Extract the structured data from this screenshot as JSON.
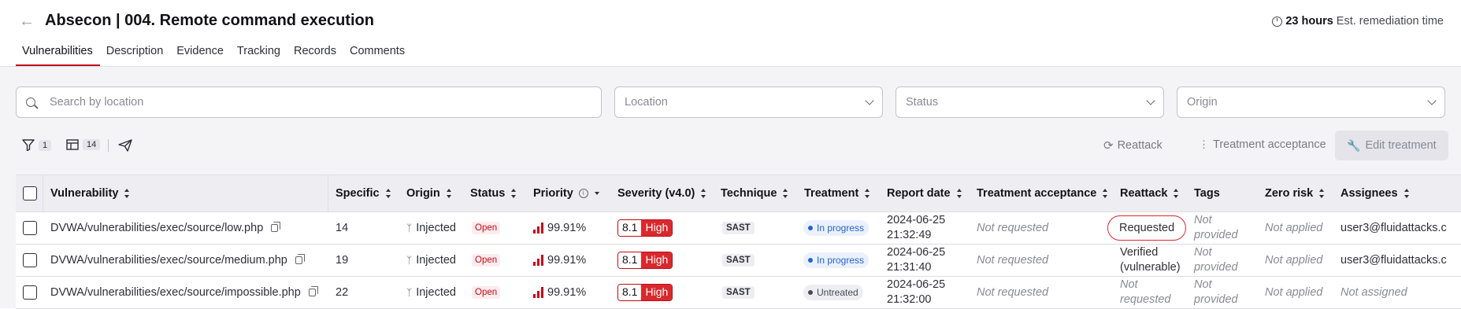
{
  "header": {
    "title": "Absecon | 004. Remote command execution",
    "remediation_hours": "23 hours",
    "remediation_label": "Est. remediation time"
  },
  "tabs": [
    {
      "label": "Vulnerabilities",
      "active": true
    },
    {
      "label": "Description"
    },
    {
      "label": "Evidence"
    },
    {
      "label": "Tracking"
    },
    {
      "label": "Records"
    },
    {
      "label": "Comments"
    }
  ],
  "filters": {
    "search_placeholder": "Search by location",
    "location_placeholder": "Location",
    "status_placeholder": "Status",
    "origin_placeholder": "Origin"
  },
  "toolbar": {
    "filter_count": "1",
    "columns_count": "14",
    "reattack_label": "Reattack",
    "treatment_acceptance_label": "Treatment acceptance",
    "edit_treatment_label": "Edit treatment"
  },
  "table": {
    "columns": [
      "Vulnerability",
      "Specific",
      "Origin",
      "Status",
      "Priority",
      "Severity (v4.0)",
      "Technique",
      "Treatment",
      "Report date",
      "Treatment acceptance",
      "Reattack",
      "Tags",
      "Zero risk",
      "Assignees"
    ],
    "rows": [
      {
        "vulnerability": "DVWA/vulnerabilities/exec/source/low.php",
        "specific": "14",
        "origin": "Injected",
        "status": "Open",
        "priority": "99.91%",
        "severity_score": "8.1",
        "severity_label": "High",
        "technique": "SAST",
        "treatment": "In progress",
        "report_date_line1": "2024-06-25",
        "report_date_line2": "21:32:49",
        "treatment_acceptance": "Not requested",
        "reattack_line1": "Requested",
        "reattack_line2": "",
        "tags_line1": "Not",
        "tags_line2": "provided",
        "zero_risk": "Not applied",
        "assignees": "user3@fluidattacks.c"
      },
      {
        "vulnerability": "DVWA/vulnerabilities/exec/source/medium.php",
        "specific": "19",
        "origin": "Injected",
        "status": "Open",
        "priority": "99.91%",
        "severity_score": "8.1",
        "severity_label": "High",
        "technique": "SAST",
        "treatment": "In progress",
        "report_date_line1": "2024-06-25",
        "report_date_line2": "21:31:40",
        "treatment_acceptance": "Not requested",
        "reattack_line1": "Verified",
        "reattack_line2": "(vulnerable)",
        "tags_line1": "Not",
        "tags_line2": "provided",
        "zero_risk": "Not applied",
        "assignees": "user3@fluidattacks.c"
      },
      {
        "vulnerability": "DVWA/vulnerabilities/exec/source/impossible.php",
        "specific": "22",
        "origin": "Injected",
        "status": "Open",
        "priority": "99.91%",
        "severity_score": "8.1",
        "severity_label": "High",
        "technique": "SAST",
        "treatment": "Untreated",
        "report_date_line1": "2024-06-25",
        "report_date_line2": "21:32:00",
        "treatment_acceptance": "Not requested",
        "reattack_line1": "Not",
        "reattack_line2": "requested",
        "tags_line1": "Not",
        "tags_line2": "provided",
        "zero_risk": "Not applied",
        "assignees": "Not assigned"
      }
    ]
  },
  "colors": {
    "accent": "#bf0b1a",
    "in_progress": "#2563c9",
    "untreated": "#65656f"
  }
}
